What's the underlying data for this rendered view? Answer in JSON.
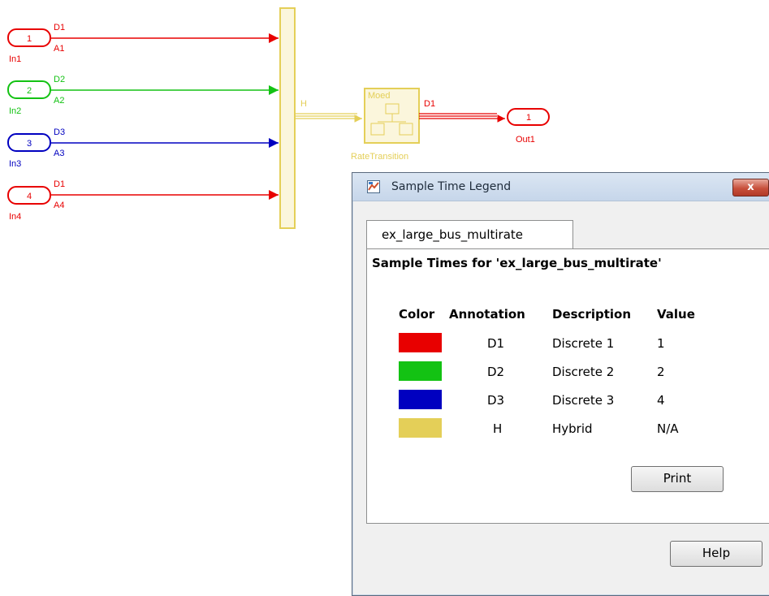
{
  "colors": {
    "d1": "#e80000",
    "d2": "#13c213",
    "d3": "#0000c0",
    "h": "#e4cf58"
  },
  "model": {
    "inports": [
      {
        "number": "1",
        "name": "In1",
        "rate_top": "D1",
        "rate_bottom": "A1"
      },
      {
        "number": "2",
        "name": "In2",
        "rate_top": "D2",
        "rate_bottom": "A2"
      },
      {
        "number": "3",
        "name": "In3",
        "rate_top": "D3",
        "rate_bottom": "A3"
      },
      {
        "number": "4",
        "name": "In4",
        "rate_top": "D1",
        "rate_bottom": "A4"
      }
    ],
    "bus_label": "H",
    "rate_transition": {
      "name": "RateTransition",
      "mode_text": "Moed"
    },
    "output_rate": "D1",
    "outport": {
      "number": "1",
      "name": "Out1"
    }
  },
  "dialog": {
    "title": "Sample Time Legend",
    "close_label": "x",
    "tab_label": "ex_large_bus_multirate",
    "heading": "Sample Times for 'ex_large_bus_multirate'",
    "columns": {
      "color": "Color",
      "annotation": "Annotation",
      "description": "Description",
      "value": "Value"
    },
    "rows": [
      {
        "color": "#e80000",
        "annotation": "D1",
        "description": "Discrete 1",
        "value": "1"
      },
      {
        "color": "#13c213",
        "annotation": "D2",
        "description": "Discrete 2",
        "value": "2"
      },
      {
        "color": "#0000c0",
        "annotation": "D3",
        "description": "Discrete 3",
        "value": "4"
      },
      {
        "color": "#e4cf58",
        "annotation": "H",
        "description": "Hybrid",
        "value": "N/A"
      }
    ],
    "print_label": "Print",
    "help_label": "Help"
  }
}
